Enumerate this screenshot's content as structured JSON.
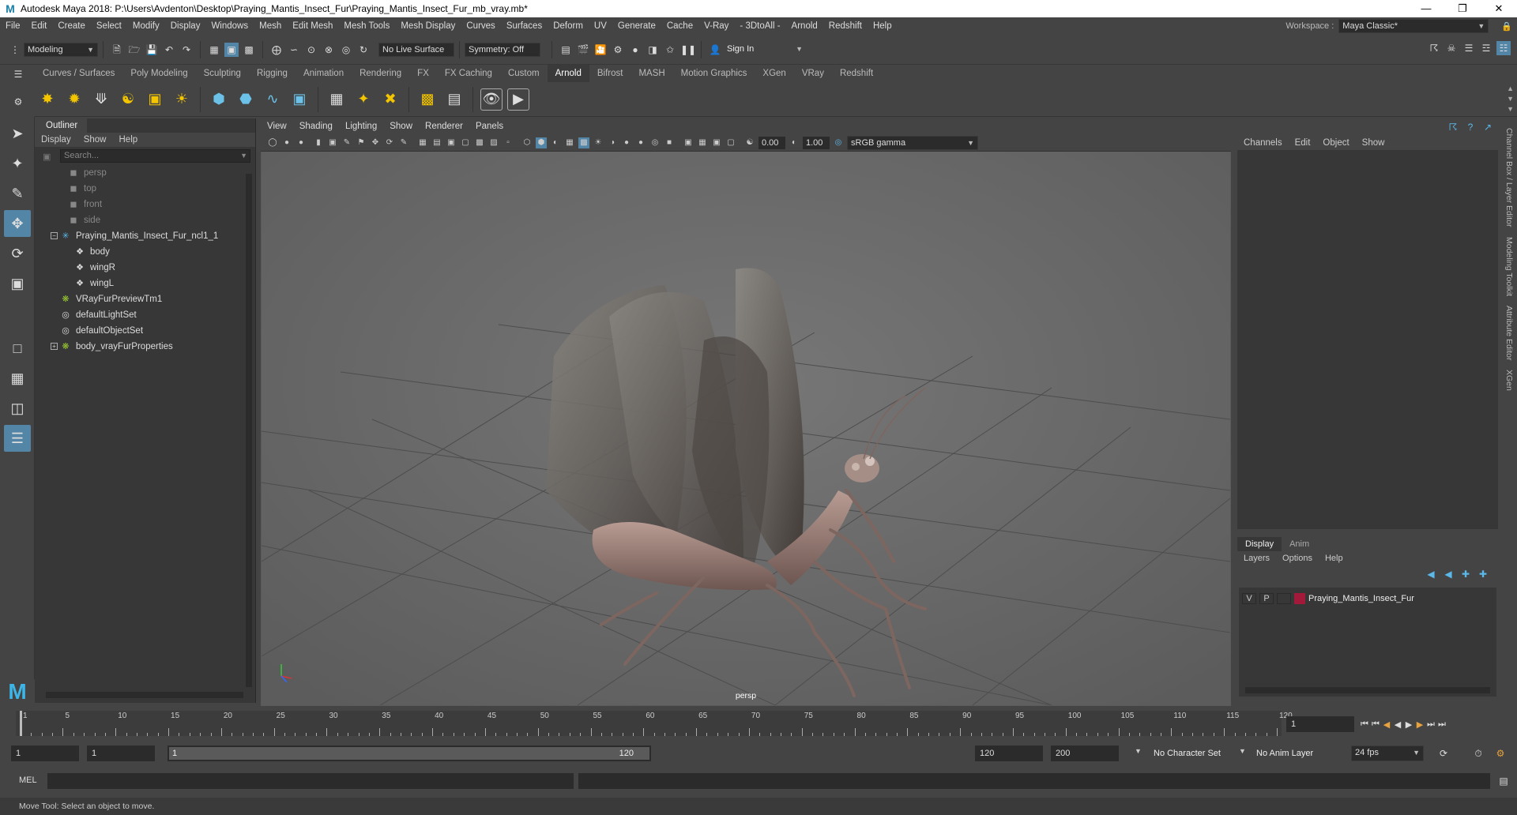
{
  "window": {
    "title": "Autodesk Maya 2018: P:\\Users\\Avdenton\\Desktop\\Praying_Mantis_Insect_Fur\\Praying_Mantis_Insect_Fur_mb_vray.mb*"
  },
  "menu": [
    "File",
    "Edit",
    "Create",
    "Select",
    "Modify",
    "Display",
    "Windows",
    "Mesh",
    "Edit Mesh",
    "Mesh Tools",
    "Mesh Display",
    "Curves",
    "Surfaces",
    "Deform",
    "UV",
    "Generate",
    "Cache",
    "V-Ray",
    "- 3DtoAll -",
    "Arnold",
    "Redshift",
    "Help"
  ],
  "workspace": {
    "label": "Workspace :",
    "value": "Maya Classic*"
  },
  "status": {
    "mode": "Modeling",
    "live_surface": "No Live Surface",
    "symmetry": "Symmetry: Off",
    "sign_in": "Sign In"
  },
  "shelf_tabs": [
    "Curves / Surfaces",
    "Poly Modeling",
    "Sculpting",
    "Rigging",
    "Animation",
    "Rendering",
    "FX",
    "FX Caching",
    "Custom",
    "Arnold",
    "Bifrost",
    "MASH",
    "Motion Graphics",
    "XGen",
    "VRay",
    "Redshift"
  ],
  "shelf_active": "Arnold",
  "outliner": {
    "title": "Outliner",
    "menu": [
      "Display",
      "Show",
      "Help"
    ],
    "search_placeholder": "Search...",
    "items": [
      {
        "label": "persp",
        "dim": true
      },
      {
        "label": "top",
        "dim": true
      },
      {
        "label": "front",
        "dim": true
      },
      {
        "label": "side",
        "dim": true
      },
      {
        "label": "Praying_Mantis_Insect_Fur_ncl1_1"
      },
      {
        "label": "body"
      },
      {
        "label": "wingR"
      },
      {
        "label": "wingL"
      },
      {
        "label": "VRayFurPreviewTm1"
      },
      {
        "label": "defaultLightSet"
      },
      {
        "label": "defaultObjectSet"
      },
      {
        "label": "body_vrayFurProperties"
      }
    ]
  },
  "viewport": {
    "menu": [
      "View",
      "Shading",
      "Lighting",
      "Show",
      "Renderer",
      "Panels"
    ],
    "near": "0.00",
    "far": "1.00",
    "color_space": "sRGB gamma",
    "camera_label": "persp"
  },
  "channel_box": {
    "menu": [
      "Channels",
      "Edit",
      "Object",
      "Show"
    ]
  },
  "layer_editor": {
    "tabs": [
      "Display",
      "Anim"
    ],
    "menu": [
      "Layers",
      "Options",
      "Help"
    ],
    "layer": {
      "v": "V",
      "p": "P",
      "name": "Praying_Mantis_Insect_Fur",
      "color": "#a3193a"
    }
  },
  "side_tabs": [
    "Channel Box / Layer Editor",
    "Modeling Toolkit",
    "Attribute Editor",
    "XGen"
  ],
  "timeline": {
    "ticks": [
      "1",
      "5",
      "10",
      "15",
      "20",
      "25",
      "30",
      "35",
      "40",
      "45",
      "50",
      "55",
      "60",
      "65",
      "70",
      "75",
      "80",
      "85",
      "90",
      "95",
      "100",
      "105",
      "110",
      "115",
      "120"
    ],
    "current_frame": "1"
  },
  "range": {
    "start": "1",
    "playback_start": "1",
    "slider_start": "1",
    "slider_end": "120",
    "playback_end": "120",
    "end": "200",
    "character_set": "No Character Set",
    "anim_layer": "No Anim Layer",
    "fps": "24 fps"
  },
  "cmdline": {
    "label": "MEL"
  },
  "helpline": {
    "text": "Move Tool: Select an object to move."
  }
}
